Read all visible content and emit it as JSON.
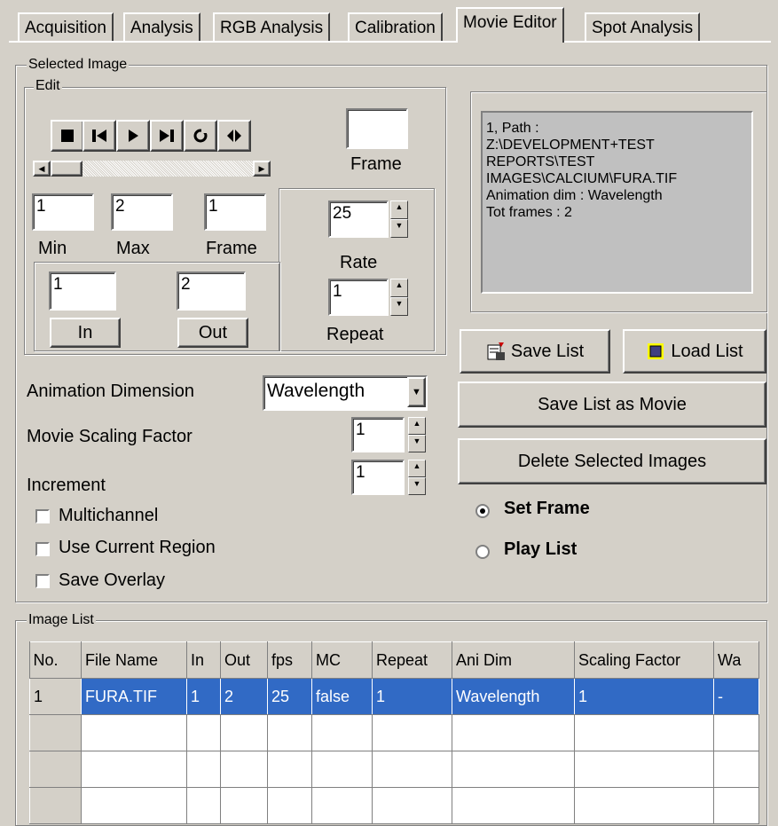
{
  "tabs": [
    {
      "label": "Acquisition"
    },
    {
      "label": "Analysis"
    },
    {
      "label": "RGB Analysis"
    },
    {
      "label": "Calibration"
    },
    {
      "label": "Movie Editor"
    },
    {
      "label": "Spot Analysis"
    }
  ],
  "selected_image": {
    "title": "Selected Image",
    "edit": {
      "title": "Edit",
      "frame_box_value": "",
      "frame_box_label": "Frame",
      "min_value": "1",
      "max_value": "2",
      "frame_value": "1",
      "min_label": "Min",
      "max_label": "Max",
      "frame_label": "Frame",
      "in_value": "1",
      "out_value": "2",
      "in_button": "In",
      "out_button": "Out",
      "rate_value": "25",
      "rate_label": "Rate",
      "repeat_value": "1",
      "repeat_label": "Repeat"
    },
    "animation_dimension_label": "Animation Dimension",
    "animation_dimension_value": "Wavelength",
    "movie_scaling_label": "Movie Scaling Factor",
    "movie_scaling_value": "1",
    "increment_label": "Increment",
    "increment_value": "1",
    "checkboxes": [
      {
        "label": "Multichannel",
        "checked": false
      },
      {
        "label": "Use Current Region",
        "checked": false
      },
      {
        "label": "Save Overlay",
        "checked": false
      }
    ]
  },
  "info_box": {
    "lines": [
      "1, Path :",
      "Z:\\DEVELOPMENT+TEST",
      "REPORTS\\TEST",
      "IMAGES\\CALCIUM\\FURA.TIF",
      "Animation dim : Wavelength",
      "Tot frames : 2"
    ]
  },
  "buttons": {
    "save_list": "Save List",
    "load_list": "Load List",
    "save_list_as_movie": "Save List as Movie",
    "delete_selected": "Delete Selected Images"
  },
  "radios": [
    {
      "label": "Set Frame",
      "selected": true
    },
    {
      "label": "Play List",
      "selected": false
    }
  ],
  "image_list": {
    "title": "Image List",
    "columns": [
      "No.",
      "File Name",
      "In",
      "Out",
      "fps",
      "MC",
      "Repeat",
      "Ani Dim",
      "Scaling Factor",
      "Wa"
    ],
    "rows": [
      [
        "1",
        "FURA.TIF",
        "1",
        "2",
        "25",
        "false",
        "1",
        "Wavelength",
        "1",
        "-"
      ]
    ]
  }
}
